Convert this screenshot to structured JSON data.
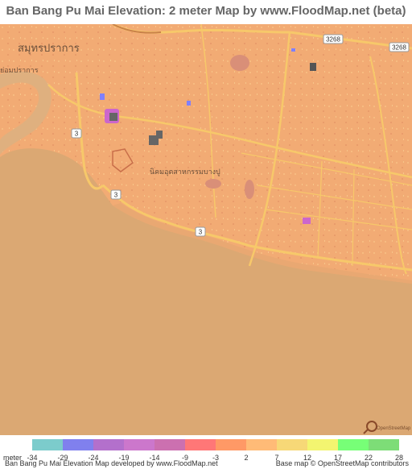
{
  "title": "Ban Bang Pu Mai Elevation: 2 meter Map by www.FloodMap.net (beta)",
  "map": {
    "places": [
      {
        "name": "สมุทรปราการ",
        "kind": "city"
      },
      {
        "name": "ย่อมปราการ",
        "kind": "district"
      },
      {
        "name": "นิคมอุตสาหกรรมบางปู",
        "kind": "area"
      }
    ],
    "roads": [
      "3268",
      "3268",
      "3",
      "3",
      "3"
    ],
    "watermark": "OpenStreetMap",
    "colors": {
      "land": "#f2ab74",
      "sea": "#dba873",
      "river": "#dfb07f",
      "road": "#f7c86a",
      "blue_patch": "#8080ff",
      "magenta_patch": "#cc66cc",
      "dark": "#555555"
    }
  },
  "legend": {
    "unit": "meter",
    "ticks": [
      "-34",
      "-29",
      "-24",
      "-19",
      "-14",
      "-9",
      "-3",
      "2",
      "7",
      "12",
      "17",
      "22",
      "28"
    ],
    "colors": [
      "#7ccccc",
      "#8080ee",
      "#b370cc",
      "#cc77cc",
      "#cc70b0",
      "#ff7777",
      "#ff9966",
      "#ffbb77",
      "#f7d877",
      "#f3f570",
      "#77ff77",
      "#7ddd77"
    ]
  },
  "footer": {
    "left": "Ban Bang Pu Mai Elevation Map developed by www.FloodMap.net",
    "right": "Base map © OpenStreetMap contributors"
  }
}
